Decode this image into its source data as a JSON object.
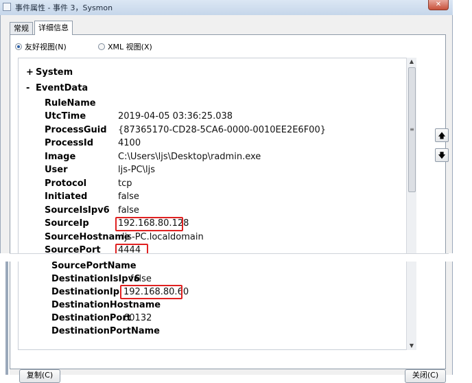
{
  "window": {
    "title": "事件属性 - 事件 3，Sysmon",
    "close_glyph": "✕"
  },
  "tabs": [
    {
      "label": "常规"
    },
    {
      "label": "详细信息"
    }
  ],
  "view_options": [
    {
      "label": "友好视图(N)",
      "selected": true
    },
    {
      "label": "XML 视图(X)",
      "selected": false
    }
  ],
  "tree": {
    "system_sign": "+",
    "system_label": "System",
    "eventdata_sign": "-",
    "eventdata_label": "EventData"
  },
  "fields": [
    {
      "key": "RuleName",
      "value": ""
    },
    {
      "key": "UtcTime",
      "value": "2019-04-05 03:36:25.038"
    },
    {
      "key": "ProcessGuid",
      "value": "{87365170-CD28-5CA6-0000-0010EE2E6F00}"
    },
    {
      "key": "ProcessId",
      "value": "4100"
    },
    {
      "key": "Image",
      "value": "C:\\Users\\ljs\\Desktop\\radmin.exe"
    },
    {
      "key": "User",
      "value": "ljs-PC\\ljs"
    },
    {
      "key": "Protocol",
      "value": "tcp"
    },
    {
      "key": "Initiated",
      "value": "false"
    },
    {
      "key": "SourceIsIpv6",
      "value": "false"
    },
    {
      "key": "SourceIp",
      "value": "192.168.80.128"
    },
    {
      "key": "SourceHostname",
      "value": "ljs-PC.localdomain"
    },
    {
      "key": "SourcePort",
      "value": "4444"
    },
    {
      "key": "SourcePortName",
      "value": ""
    },
    {
      "key": "DestinationIsIpv6",
      "value": "false"
    },
    {
      "key": "DestinationIp",
      "value": "192.168.80.60"
    },
    {
      "key": "DestinationHostname",
      "value": ""
    },
    {
      "key": "DestinationPort",
      "value": "60132"
    },
    {
      "key": "DestinationPortName",
      "value": ""
    }
  ],
  "side_buttons": {
    "up_glyph": "🡅",
    "down_glyph": "🡇"
  },
  "bottom_buttons": {
    "copy": "复制(C)",
    "close": "关闭(C)"
  },
  "colors": {
    "highlight": "#e02020",
    "accent": "#2a5fa8"
  }
}
